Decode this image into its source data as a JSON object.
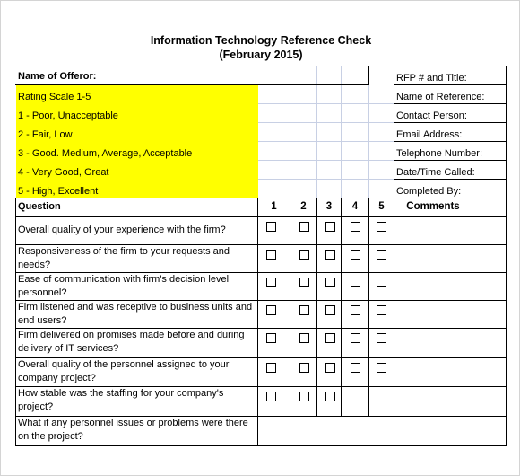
{
  "document": {
    "title": "Information Technology Reference Check",
    "subtitle": "(February 2015)"
  },
  "header": {
    "offeror_label": "Name of Offeror:",
    "rating_scale": [
      "Rating Scale 1-5",
      "1 - Poor, Unacceptable",
      "2 - Fair, Low",
      "3 - Good. Medium, Average, Acceptable",
      "4 - Very Good, Great",
      "5 - High, Excellent"
    ],
    "right_fields": [
      "RFP # and Title:",
      "Name of Reference:",
      "Contact Person:",
      "Email Address:",
      "Telephone Number:",
      "Date/Time Called:",
      "Completed By:"
    ],
    "highlight_color": "#ffff00"
  },
  "table": {
    "question_header": "Question",
    "rating_headers": [
      "1",
      "2",
      "3",
      "4",
      "5"
    ],
    "comments_header": "Comments",
    "questions": [
      "Overall quality of your experience with the firm?",
      "Responsiveness of the firm to your requests and needs?",
      "Ease of communication with firm's decision level personnel?",
      "Firm listened and was receptive to business units and end users?",
      "Firm delivered on promises made before and during delivery of IT services?",
      "Overall quality of the personnel assigned to your company project?",
      "How stable was the staffing for your company's project?",
      "What if any personnel issues or problems were there on the project?"
    ]
  }
}
